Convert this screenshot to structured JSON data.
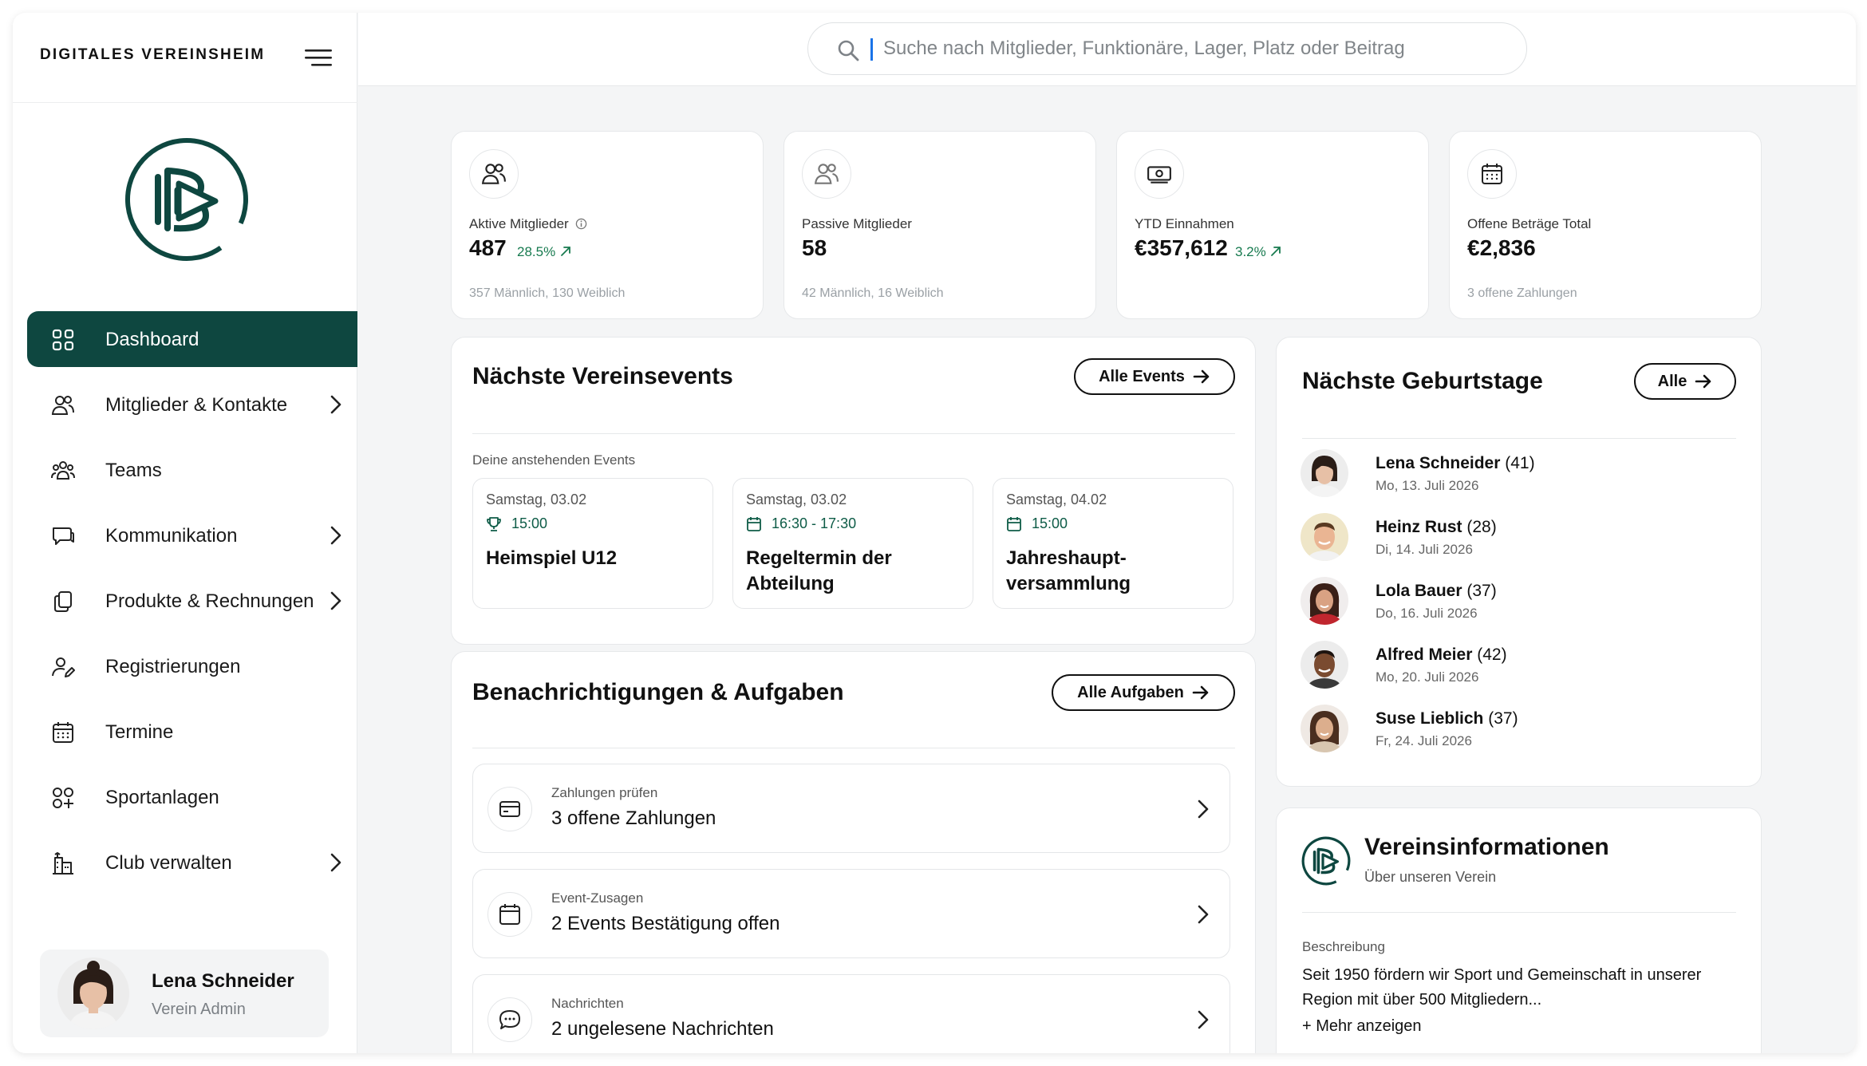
{
  "app": {
    "title": "DIGITALES VEREINSHEIM"
  },
  "search": {
    "placeholder": "Suche nach Mitglieder, Funktionäre, Lager, Platz oder Beitrag"
  },
  "sidebar": {
    "items": [
      {
        "label": "Dashboard",
        "icon": "dashboard-grid-icon",
        "active": true
      },
      {
        "label": "Mitglieder & Kontakte",
        "icon": "users-icon",
        "chevron": true
      },
      {
        "label": "Teams",
        "icon": "teams-icon"
      },
      {
        "label": "Kommunikation",
        "icon": "chat-icon",
        "chevron": true
      },
      {
        "label": "Produkte & Rechnungen",
        "icon": "documents-icon",
        "chevron": true
      },
      {
        "label": "Registrierungen",
        "icon": "user-edit-icon"
      },
      {
        "label": "Termine",
        "icon": "calendar-icon"
      },
      {
        "label": "Sportanlagen",
        "icon": "facilities-icon"
      },
      {
        "label": "Club verwalten",
        "icon": "building-icon",
        "chevron": true
      }
    ],
    "user": {
      "name": "Lena Schneider",
      "role": "Verein Admin"
    }
  },
  "stats": [
    {
      "label": "Aktive Mitglieder",
      "value": "487",
      "trend": "28.5%",
      "sub": "357 Männlich, 130 Weiblich",
      "icon": "users-icon"
    },
    {
      "label": "Passive Mitglieder",
      "value": "58",
      "trend": "",
      "sub": "42 Männlich, 16 Weiblich",
      "icon": "users-icon"
    },
    {
      "label": "YTD Einnahmen",
      "value": "€357,612",
      "trend": "3.2%",
      "sub": "",
      "icon": "money-icon"
    },
    {
      "label": "Offene Beträge Total",
      "value": "€2,836",
      "trend": "",
      "sub": "3 offene Zahlungen",
      "icon": "calendar-icon"
    }
  ],
  "events": {
    "title": "Nächste Vereinsevents",
    "button": "Alle Events",
    "subtitle": "Deine anstehenden Events",
    "items": [
      {
        "date": "Samstag, 03.02",
        "time": "15:00",
        "title": "Heimspiel U12",
        "icon": "trophy-icon"
      },
      {
        "date": "Samstag, 03.02",
        "time": "16:30 - 17:30",
        "title": "Regeltermin der Abteilung",
        "icon": "calendar-icon"
      },
      {
        "date": "Samstag, 04.02",
        "time": "15:00",
        "title": "Jahreshaupt-versammlung",
        "icon": "calendar-icon"
      }
    ]
  },
  "tasks": {
    "title": "Benachrichtigungen & Aufgaben",
    "button": "Alle Aufgaben",
    "items": [
      {
        "category": "Zahlungen prüfen",
        "text": "3 offene Zahlungen",
        "icon": "credit-card-icon"
      },
      {
        "category": "Event-Zusagen",
        "text": "2 Events Bestätigung offen",
        "icon": "calendar-icon"
      },
      {
        "category": "Nachrichten",
        "text": "2 ungelesene Nachrichten",
        "icon": "message-icon"
      }
    ]
  },
  "birthdays": {
    "title": "Nächste Geburtstage",
    "button": "Alle",
    "items": [
      {
        "name": "Lena Schneider",
        "age": "(41)",
        "date": "Mo, 13. Juli 2026"
      },
      {
        "name": "Heinz Rust",
        "age": "(28)",
        "date": "Di, 14. Juli 2026"
      },
      {
        "name": "Lola Bauer",
        "age": "(37)",
        "date": "Do, 16. Juli 2026"
      },
      {
        "name": "Alfred Meier",
        "age": "(42)",
        "date": "Mo, 20. Juli 2026"
      },
      {
        "name": "Suse Lieblich",
        "age": "(37)",
        "date": "Fr, 24. Juli 2026"
      }
    ]
  },
  "info": {
    "title": "Vereinsinformationen",
    "subtitle": "Über unseren Verein",
    "label": "Beschreibung",
    "text": "Seit 1950 fördern wir Sport und Gemeinschaft in unserer Region mit über 500 Mitgliedern...",
    "more": "+ Mehr anzeigen"
  },
  "colors": {
    "primary": "#0e4740",
    "trend": "#177a4f",
    "background": "#f4f5f6"
  }
}
